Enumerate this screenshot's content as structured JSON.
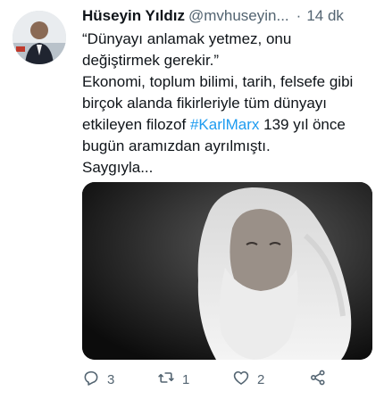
{
  "tweet": {
    "author_name": "Hüseyin Yıldız",
    "author_handle": "@mvhuseyin...",
    "separator": "·",
    "time": "14 dk",
    "text_lines": [
      "“Dünyayı anlamak yetmez, onu",
      "değiştirmek gerekir.”",
      "Ekonomi, toplum bilimi, tarih, felsefe gibi",
      "birçok alanda fikirleriyle tüm dünyayı"
    ],
    "line5_before": "etkileyen filozof ",
    "hashtag": "#KarlMarx",
    "line5_after": " 139 yıl önce",
    "line6": "bugün aramızdan ayrılmıştı.",
    "line7": "Saygıyla..."
  },
  "actions": {
    "reply_count": "3",
    "retweet_count": "1",
    "like_count": "2"
  },
  "colors": {
    "text": "#0f1419",
    "secondary": "#536471",
    "link": "#1d9bf0"
  },
  "icons": [
    "avatar",
    "reply-icon",
    "retweet-icon",
    "like-icon",
    "share-icon"
  ]
}
